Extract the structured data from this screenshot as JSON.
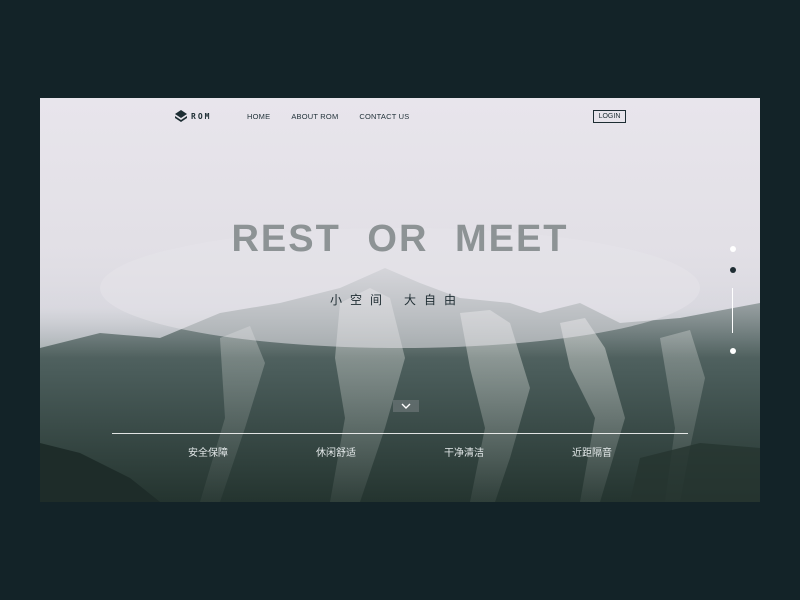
{
  "brand": {
    "logo_text": "ROM"
  },
  "nav": {
    "items": [
      "HOME",
      "ABOUT ROM",
      "CONTACT US"
    ],
    "login_label": "LOGIN"
  },
  "hero": {
    "title": "REST OR MEET",
    "subtitle_left": "小空间",
    "subtitle_right": "大自由"
  },
  "features": [
    "安全保障",
    "休闲舒适",
    "干净清洁",
    "近距隔音"
  ],
  "icons": {
    "logo": "rom-logo-icon",
    "scroll": "chevron-down-icon"
  },
  "colors": {
    "page_background": "#132328",
    "text_dark": "#1f2d33",
    "dot_active": "#1f2d33",
    "dot_inactive": "#ffffff"
  },
  "slider": {
    "active_index": 1,
    "count": 3
  }
}
